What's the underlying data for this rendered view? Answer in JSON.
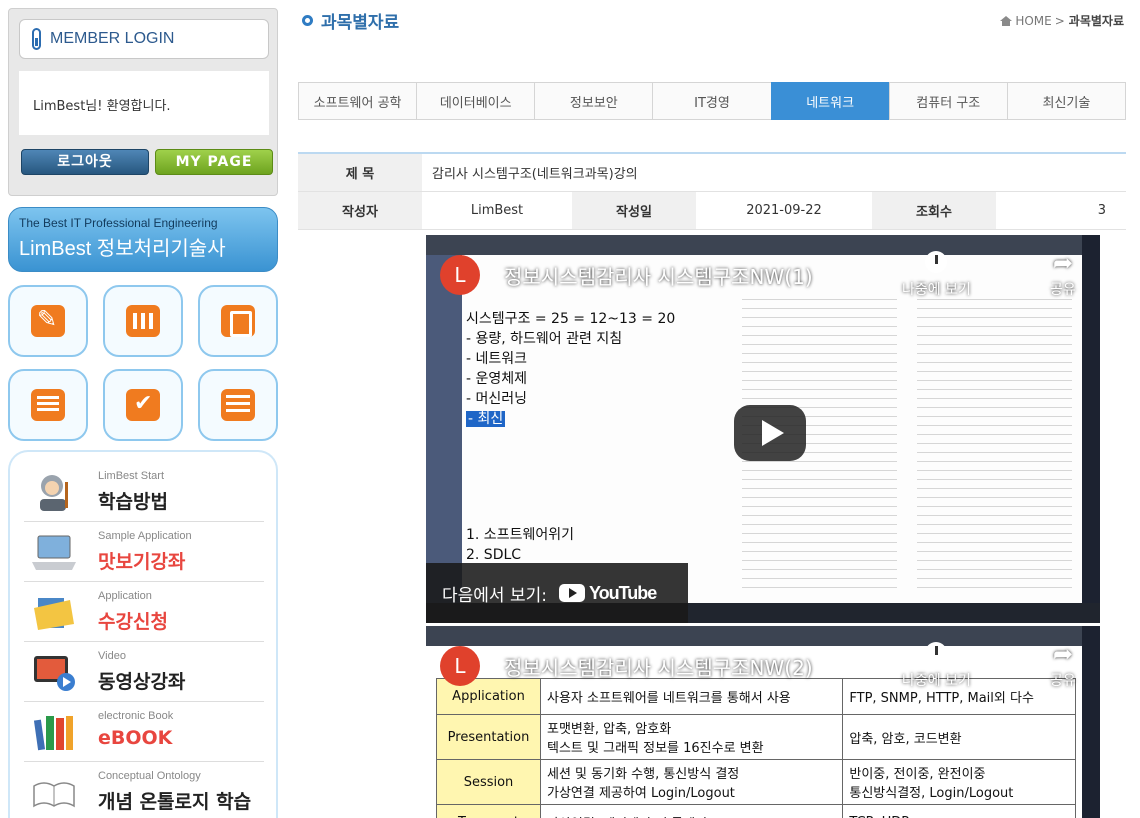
{
  "login": {
    "title": "MEMBER LOGIN",
    "welcome": "LimBest님! 환영합니다.",
    "logout_label": "로그아웃",
    "mypage_label": "MY PAGE"
  },
  "brand": {
    "sub": "The Best IT Professional Engineering",
    "main": "LimBest 정보처리기술사"
  },
  "quick_icons": [
    "pencil-icon",
    "bar-chart-icon",
    "book-icon",
    "board-list-icon",
    "checkbox-icon",
    "list-icon"
  ],
  "menu": [
    {
      "sub": "LimBest Start",
      "label": "학습방법",
      "color": "#222222",
      "icon": "student-icon"
    },
    {
      "sub": "Sample Application",
      "label": "맛보기강좌",
      "color": "#e8463f",
      "icon": "laptop-icon"
    },
    {
      "sub": "Application",
      "label": "수강신청",
      "color": "#e8463f",
      "icon": "folder-icon"
    },
    {
      "sub": "Video",
      "label": "동영상강좌",
      "color": "#222222",
      "icon": "tv-play-icon"
    },
    {
      "sub": "electronic Book",
      "label": "eBOOK",
      "color": "#e8463f",
      "icon": "books-icon"
    },
    {
      "sub": "Conceptual Ontology",
      "label": "개념 온톨로지 학습",
      "color": "#222222",
      "icon": "open-book-icon"
    }
  ],
  "page": {
    "title": "과목별자료",
    "breadcrumb_home": "HOME",
    "breadcrumb_sep": ">",
    "breadcrumb_current": "과목별자료"
  },
  "tabs": [
    {
      "label": "소프트웨어 공학",
      "active": false
    },
    {
      "label": "데이터베이스",
      "active": false
    },
    {
      "label": "정보보안",
      "active": false
    },
    {
      "label": "IT경영",
      "active": false
    },
    {
      "label": "네트워크",
      "active": true
    },
    {
      "label": "컴퓨터 구조",
      "active": false
    },
    {
      "label": "최신기술",
      "active": false
    }
  ],
  "post": {
    "subject_label": "제 목",
    "subject": "감리사 시스템구조(네트워크과목)강의",
    "author_label": "작성자",
    "author": "LimBest",
    "date_label": "작성일",
    "date": "2021-09-22",
    "views_label": "조회수",
    "views": "3"
  },
  "videos": [
    {
      "avatar": "L",
      "title": "정보시스템감리사 시스템구조NW(1)",
      "watch_later": "나중에 보기",
      "share": "공유",
      "watch_on": "다음에서 보기:",
      "youtube": "YouTube",
      "slide_lines": [
        "시스템구조 = 25 = 12~13 = 20",
        "- 용량, 하드웨어 관련 지침",
        "- 네트워크",
        "- 운영체제",
        "- 머신러닝"
      ],
      "slide_highlight": "- 최신",
      "slide_list2": [
        "1. 소프트웨어위기",
        "2. SDLC"
      ]
    },
    {
      "avatar": "L",
      "title": "정보시스템감리사 시스템구조NW(2)",
      "watch_later": "나중에 보기",
      "share": "공유",
      "osi_rows": [
        {
          "layer": "Application",
          "desc": "사용자 소프트웨어를 네트워크를 통해서 사용",
          "proto": "FTP, SNMP, HTTP, Mail외 다수"
        },
        {
          "layer": "Presentation",
          "desc": "포맷변환, 압축, 암호화\n텍스트 및 그래픽 정보를 16진수로 변환",
          "proto": "압축, 암호, 코드변환"
        },
        {
          "layer": "Session",
          "desc": "세션 및 동기화 수행, 통신방식 결정\n가상연결 제공하여 Login/Logout",
          "proto": "반이중, 전이중, 완전이중\n통신방식결정, Login/Logout"
        },
        {
          "layer": "Transport",
          "desc": "가상연결, 에러제어, 흐름제어, Segment",
          "proto": "TCP, UDP"
        }
      ]
    }
  ]
}
